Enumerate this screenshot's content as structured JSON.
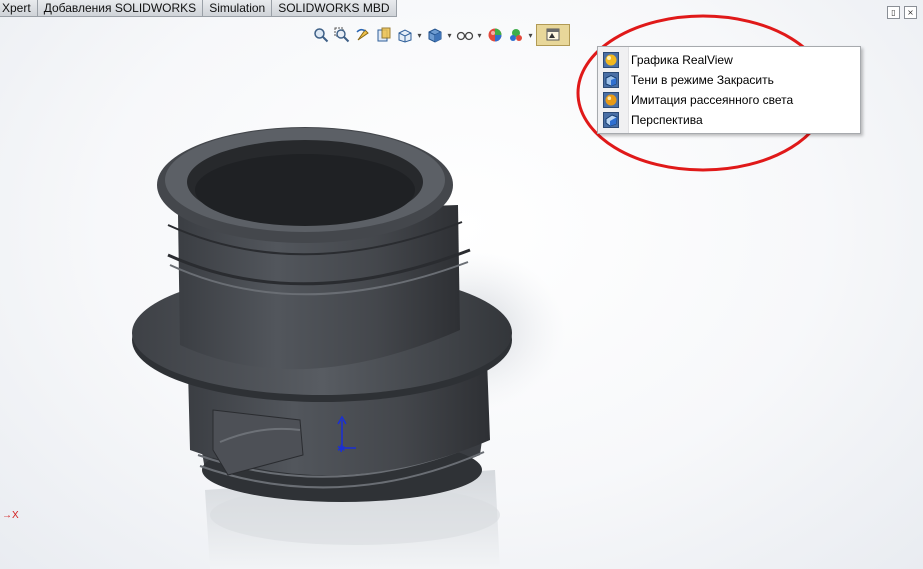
{
  "tabs": [
    "Xpert",
    "Добавления SOLIDWORKS",
    "Simulation",
    "SOLIDWORKS MBD"
  ],
  "hud_icons": [
    "zoom-to-fit-icon",
    "zoom-to-area-icon",
    "previous-view-icon",
    "section-view-icon",
    "view-orientation-icon",
    "display-style-icon",
    "hide-show-items-icon",
    "edit-appearance-icon",
    "apply-scene-icon",
    "view-settings-icon"
  ],
  "menu": {
    "items": [
      {
        "label": "Графика RealView",
        "icon": "realview-sphere-icon"
      },
      {
        "label": "Тени в режиме Закрасить",
        "icon": "shadows-cube-icon"
      },
      {
        "label": "Имитация рассеянного света",
        "icon": "ambient-occlusion-sphere-icon"
      },
      {
        "label": "Перспектива",
        "icon": "perspective-cube-icon"
      }
    ]
  },
  "annotation_color": "#e01919",
  "part_color": "#4a4d52",
  "triad_label": "X"
}
